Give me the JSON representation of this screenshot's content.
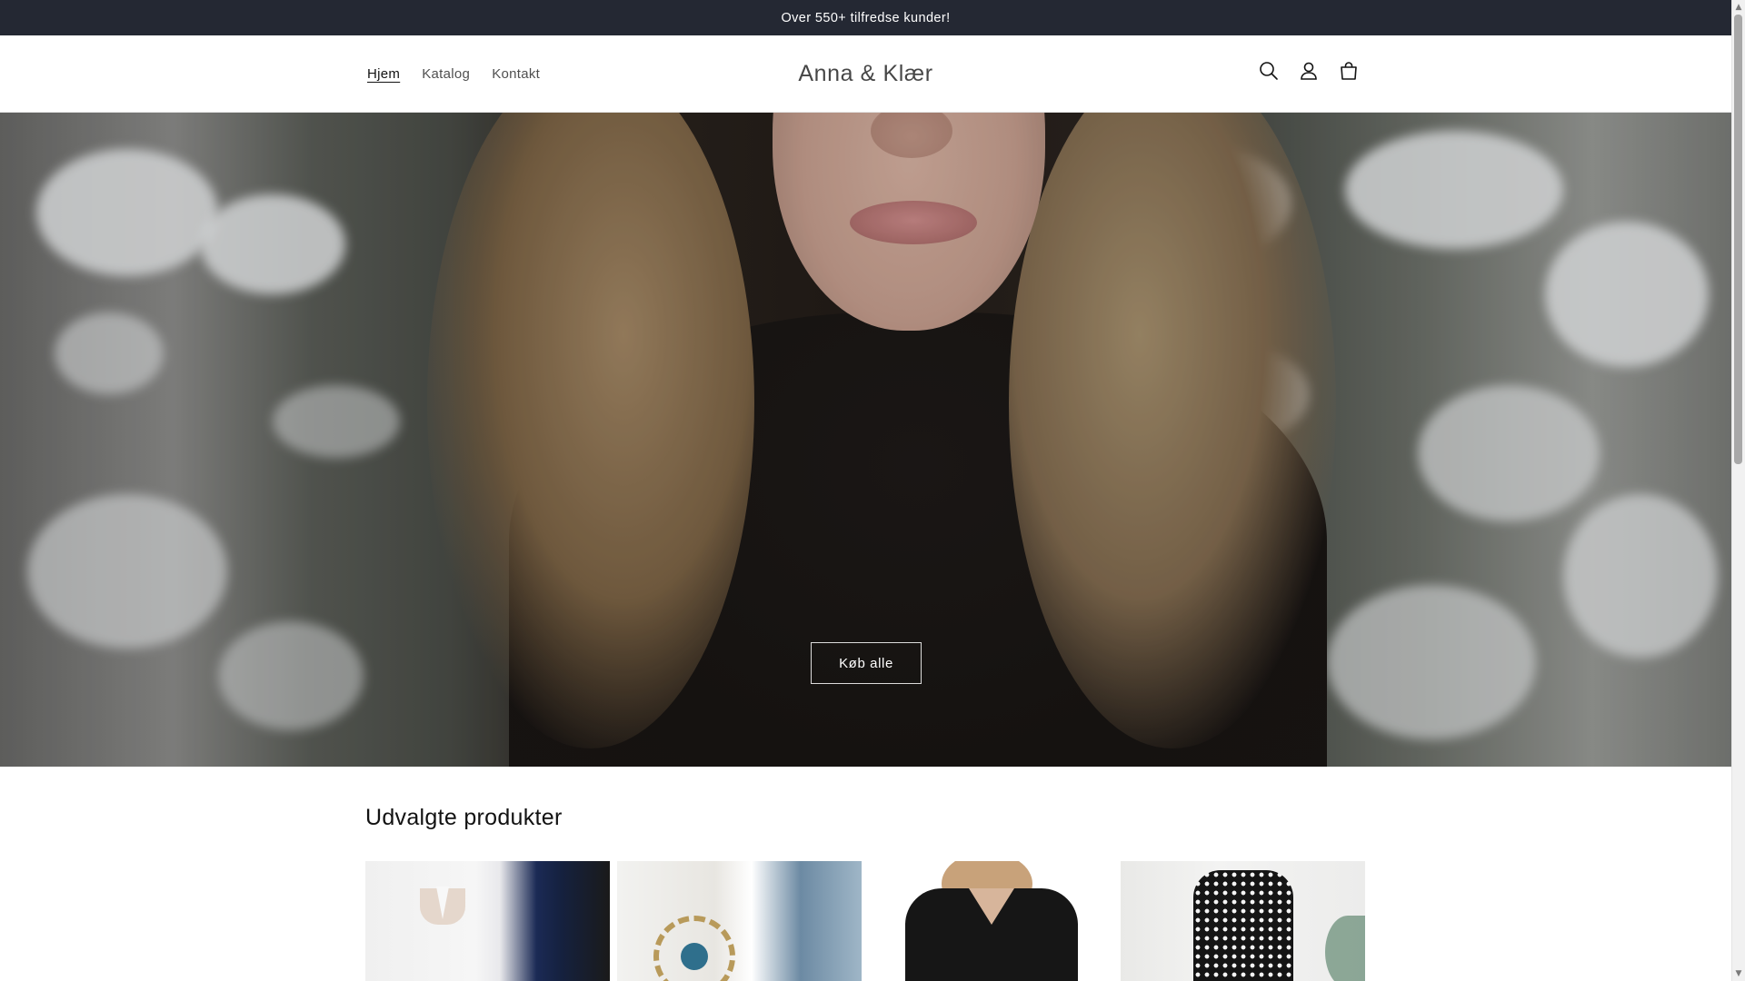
{
  "announcement": {
    "text": "Over 550+ tilfredse kunder!"
  },
  "header": {
    "nav": [
      {
        "label": "Hjem",
        "active": true
      },
      {
        "label": "Katalog",
        "active": false
      },
      {
        "label": "Kontakt",
        "active": false
      }
    ],
    "logo": "Anna & Klær",
    "icons": [
      "search-icon",
      "account-icon",
      "cart-icon"
    ]
  },
  "hero": {
    "button_label": "Køb alle"
  },
  "featured": {
    "title": "Udvalgte produkter",
    "products": [
      {
        "image": "white-navy-black-polo-shirts"
      },
      {
        "image": "white-linen-eye-embroidered-garment"
      },
      {
        "image": "black-v-neck-puff-sleeve-top"
      },
      {
        "image": "black-polka-dot-dress"
      }
    ]
  },
  "colors": {
    "announcement_bg": "#242833",
    "text": "#121212",
    "background": "#ffffff"
  }
}
